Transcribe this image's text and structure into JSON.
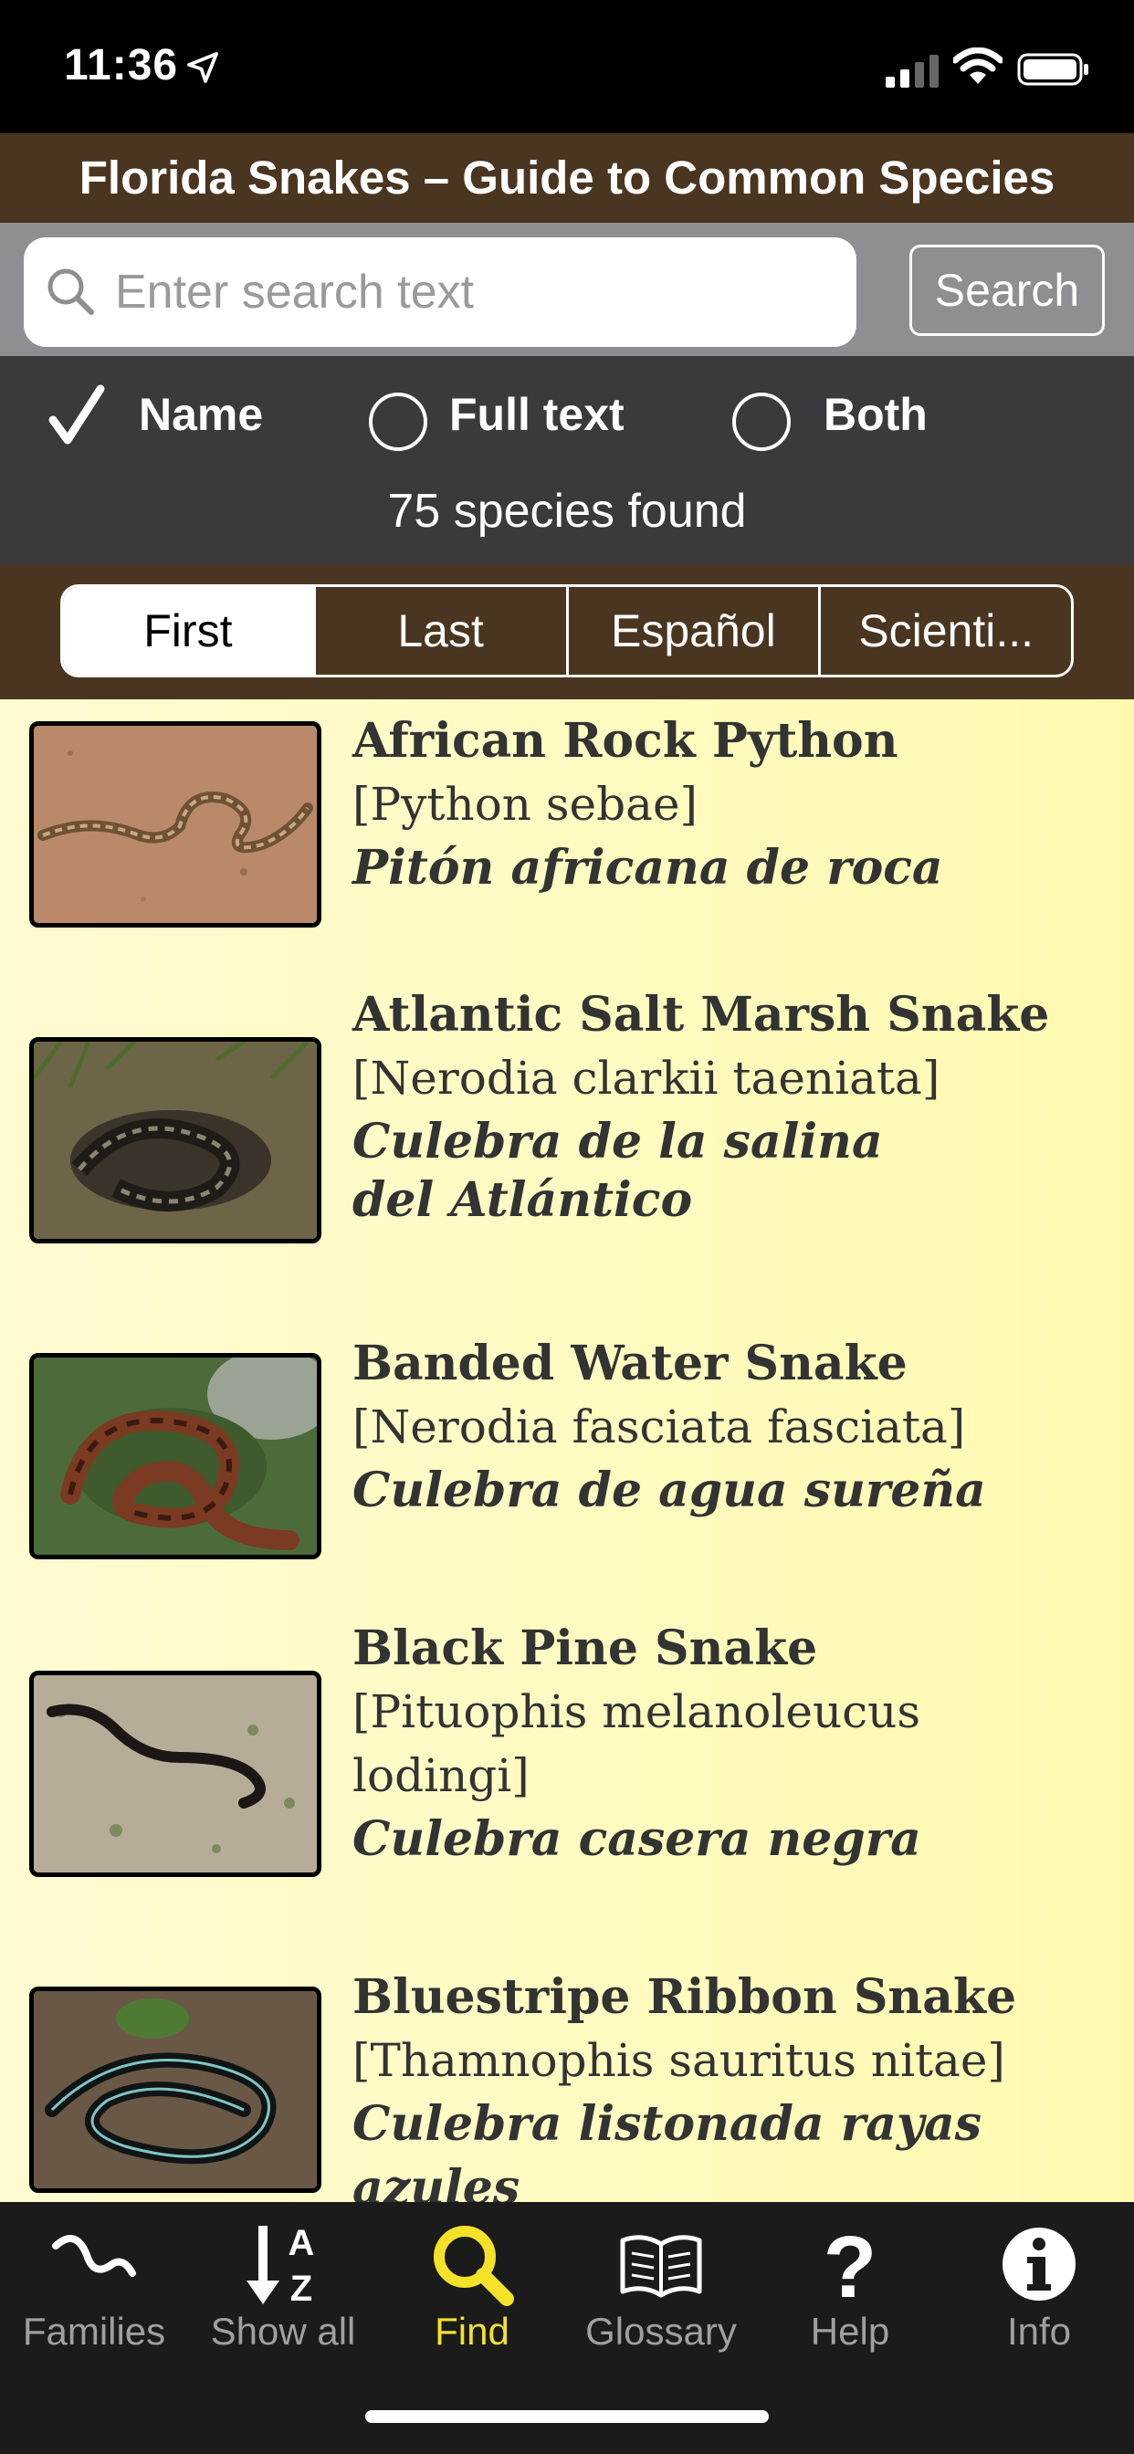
{
  "status_bar": {
    "time": "11:36"
  },
  "header": {
    "title": "Florida Snakes – Guide to Common Species"
  },
  "search": {
    "placeholder": "Enter search text",
    "button_label": "Search"
  },
  "filters": {
    "options": [
      {
        "label": "Name",
        "selected": true
      },
      {
        "label": "Full text",
        "selected": false
      },
      {
        "label": "Both",
        "selected": false
      }
    ],
    "result_count": "75 species found"
  },
  "sort_segments": {
    "items": [
      {
        "label": "First",
        "active": true
      },
      {
        "label": "Last",
        "active": false
      },
      {
        "label": "Español",
        "active": false
      },
      {
        "label": "Scienti...",
        "active": false
      }
    ]
  },
  "species": [
    {
      "common": "African Rock Python",
      "scientific": "[Python sebae]",
      "spanish": "Pitón africana de roca"
    },
    {
      "common": "Atlantic Salt Marsh Snake",
      "scientific": "[Nerodia clarkii taeniata]",
      "spanish_l1": "Culebra de la salina",
      "spanish_l2": "del Atlántico"
    },
    {
      "common": "Banded Water Snake",
      "scientific": "[Nerodia fasciata fasciata]",
      "spanish": "Culebra de agua sureña"
    },
    {
      "common": "Black Pine Snake",
      "scientific_l1": "[Pituophis melanoleucus",
      "scientific_l2": "lodingi]",
      "spanish": "Culebra casera negra"
    },
    {
      "common": "Bluestripe Ribbon Snake",
      "scientific": "[Thamnophis sauritus nitae]",
      "spanish": "Culebra listonada rayas azules"
    }
  ],
  "tab_bar": {
    "tabs": [
      {
        "label": "Families",
        "icon": "snake-icon",
        "active": false
      },
      {
        "label": "Show all",
        "icon": "sort-az-icon",
        "active": false
      },
      {
        "label": "Find",
        "icon": "search-icon",
        "active": true
      },
      {
        "label": "Glossary",
        "icon": "book-icon",
        "active": false
      },
      {
        "label": "Help",
        "icon": "question-icon",
        "active": false
      },
      {
        "label": "Info",
        "icon": "info-icon",
        "active": false
      }
    ]
  },
  "colors": {
    "header_brown": "#4a3520",
    "list_yellow": "#fffab0",
    "active_tab": "#f4e12a"
  }
}
